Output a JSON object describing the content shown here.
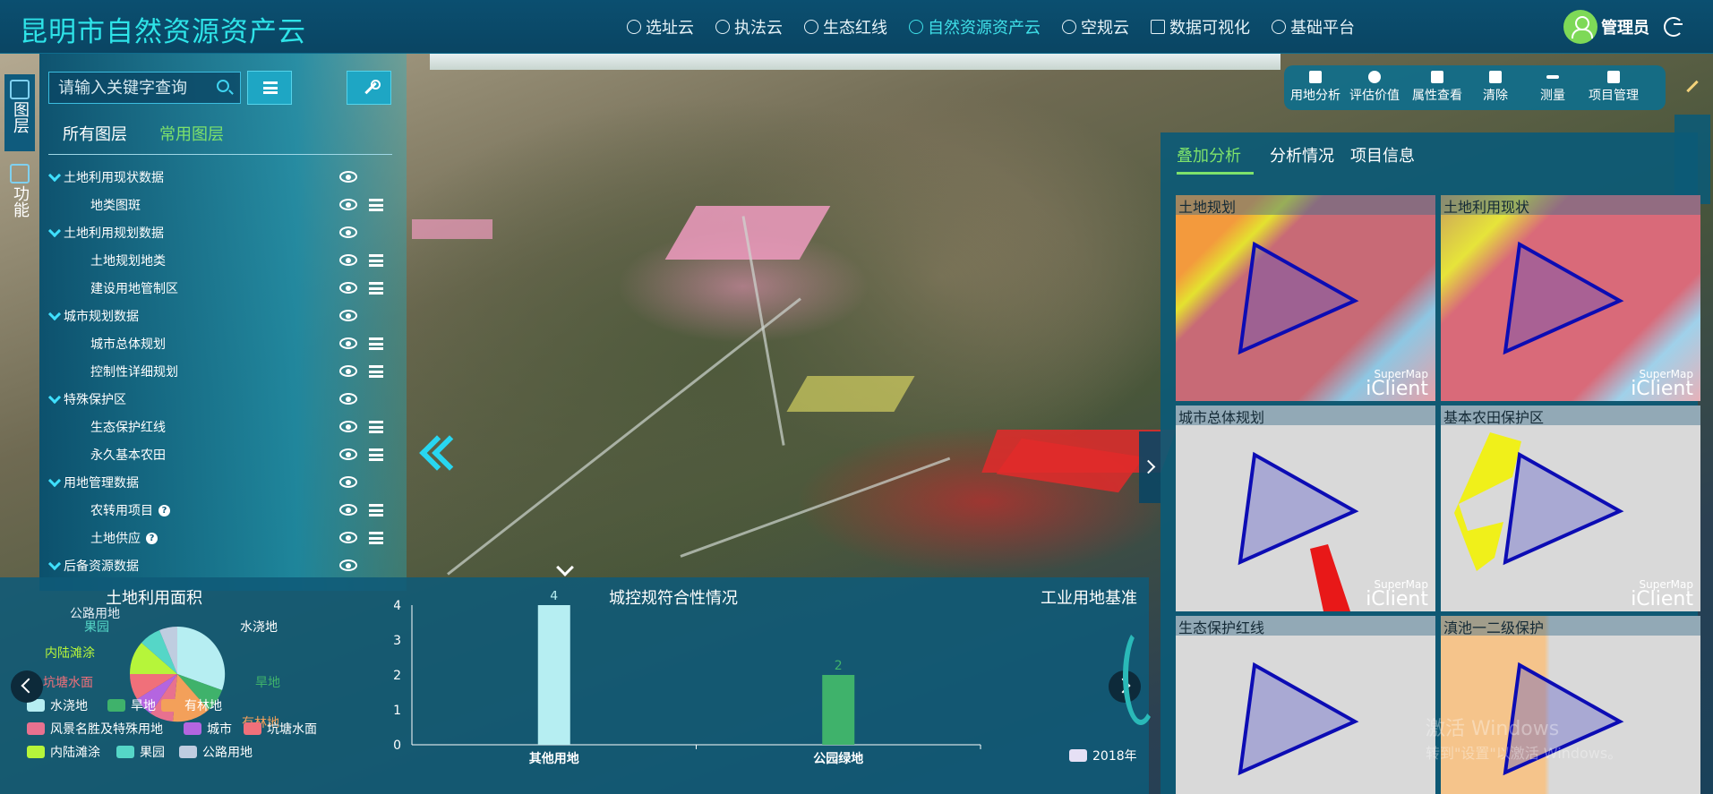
{
  "header": {
    "title": "昆明市自然资源资产云",
    "nav": [
      {
        "label": "选址云"
      },
      {
        "label": "执法云"
      },
      {
        "label": "生态红线"
      },
      {
        "label": "自然资源资产云"
      },
      {
        "label": "空规云"
      },
      {
        "label": "数据可视化"
      },
      {
        "label": "基础平台"
      }
    ],
    "user_name": "管理员"
  },
  "left_rail": {
    "layers": "图层",
    "functions": "功能"
  },
  "search": {
    "placeholder": "请输入关键字查询"
  },
  "layer_tabs": {
    "all": "所有图层",
    "common": "常用图层"
  },
  "tree": [
    {
      "label": "土地利用现状数据",
      "group": true
    },
    {
      "label": "地类图斑",
      "group": false
    },
    {
      "label": "土地利用规划数据",
      "group": true
    },
    {
      "label": "土地规划地类",
      "group": false
    },
    {
      "label": "建设用地管制区",
      "group": false
    },
    {
      "label": "城市规划数据",
      "group": true
    },
    {
      "label": "城市总体规划",
      "group": false
    },
    {
      "label": "控制性详细规划",
      "group": false
    },
    {
      "label": "特殊保护区",
      "group": true
    },
    {
      "label": "生态保护红线",
      "group": false
    },
    {
      "label": "永久基本农田",
      "group": false
    },
    {
      "label": "用地管理数据",
      "group": true
    },
    {
      "label": "农转用项目",
      "group": false
    },
    {
      "label": "土地供应",
      "group": false
    },
    {
      "label": "后备资源数据",
      "group": true
    }
  ],
  "pie": {
    "title": "土地利用面积",
    "labels": [
      "水浇地",
      "旱地",
      "有林地",
      "坑塘水面",
      "内陆滩涂",
      "果园",
      "公路用地"
    ],
    "legend": [
      "水浇地",
      "旱地",
      "有林地",
      "风景名胜及特殊用地",
      "城市",
      "坑塘水面",
      "内陆滩涂",
      "果园",
      "公路用地"
    ],
    "colors": [
      "#b6eef2",
      "#3fb26b",
      "#f3a05a",
      "#e8718f",
      "#b465e0",
      "#f0707a",
      "#b6f53a",
      "#55d6c7",
      "#bfcde0"
    ]
  },
  "chart_data": {
    "type": "bar",
    "title": "城控规符合性情况",
    "categories": [
      "其他用地",
      "公园绿地"
    ],
    "values": [
      4,
      2
    ],
    "ylim": [
      0,
      4
    ],
    "yticks": [
      0,
      1,
      2,
      3,
      4
    ],
    "colors": [
      "#b6eef2",
      "#3fb26b"
    ]
  },
  "third_chart": {
    "title": "工业用地基准",
    "legend": "2018年"
  },
  "right_toolbar": [
    "用地分析",
    "评估价值",
    "属性查看",
    "清除",
    "测量",
    "项目管理"
  ],
  "right_tabs": [
    "叠加分析",
    "分析情况",
    "项目信息"
  ],
  "tiles": [
    {
      "label": "土地规划"
    },
    {
      "label": "土地利用现状"
    },
    {
      "label": "城市总体规划"
    },
    {
      "label": "基本农田保护区"
    },
    {
      "label": "生态保护红线"
    },
    {
      "label": "滇池一二级保护"
    }
  ],
  "tile_watermark": {
    "small": "SuperMap",
    "big": "iClient"
  },
  "windows_watermark": {
    "line1": "激活 Windows",
    "line2": "转到\"设置\"以激活 Windows。"
  }
}
